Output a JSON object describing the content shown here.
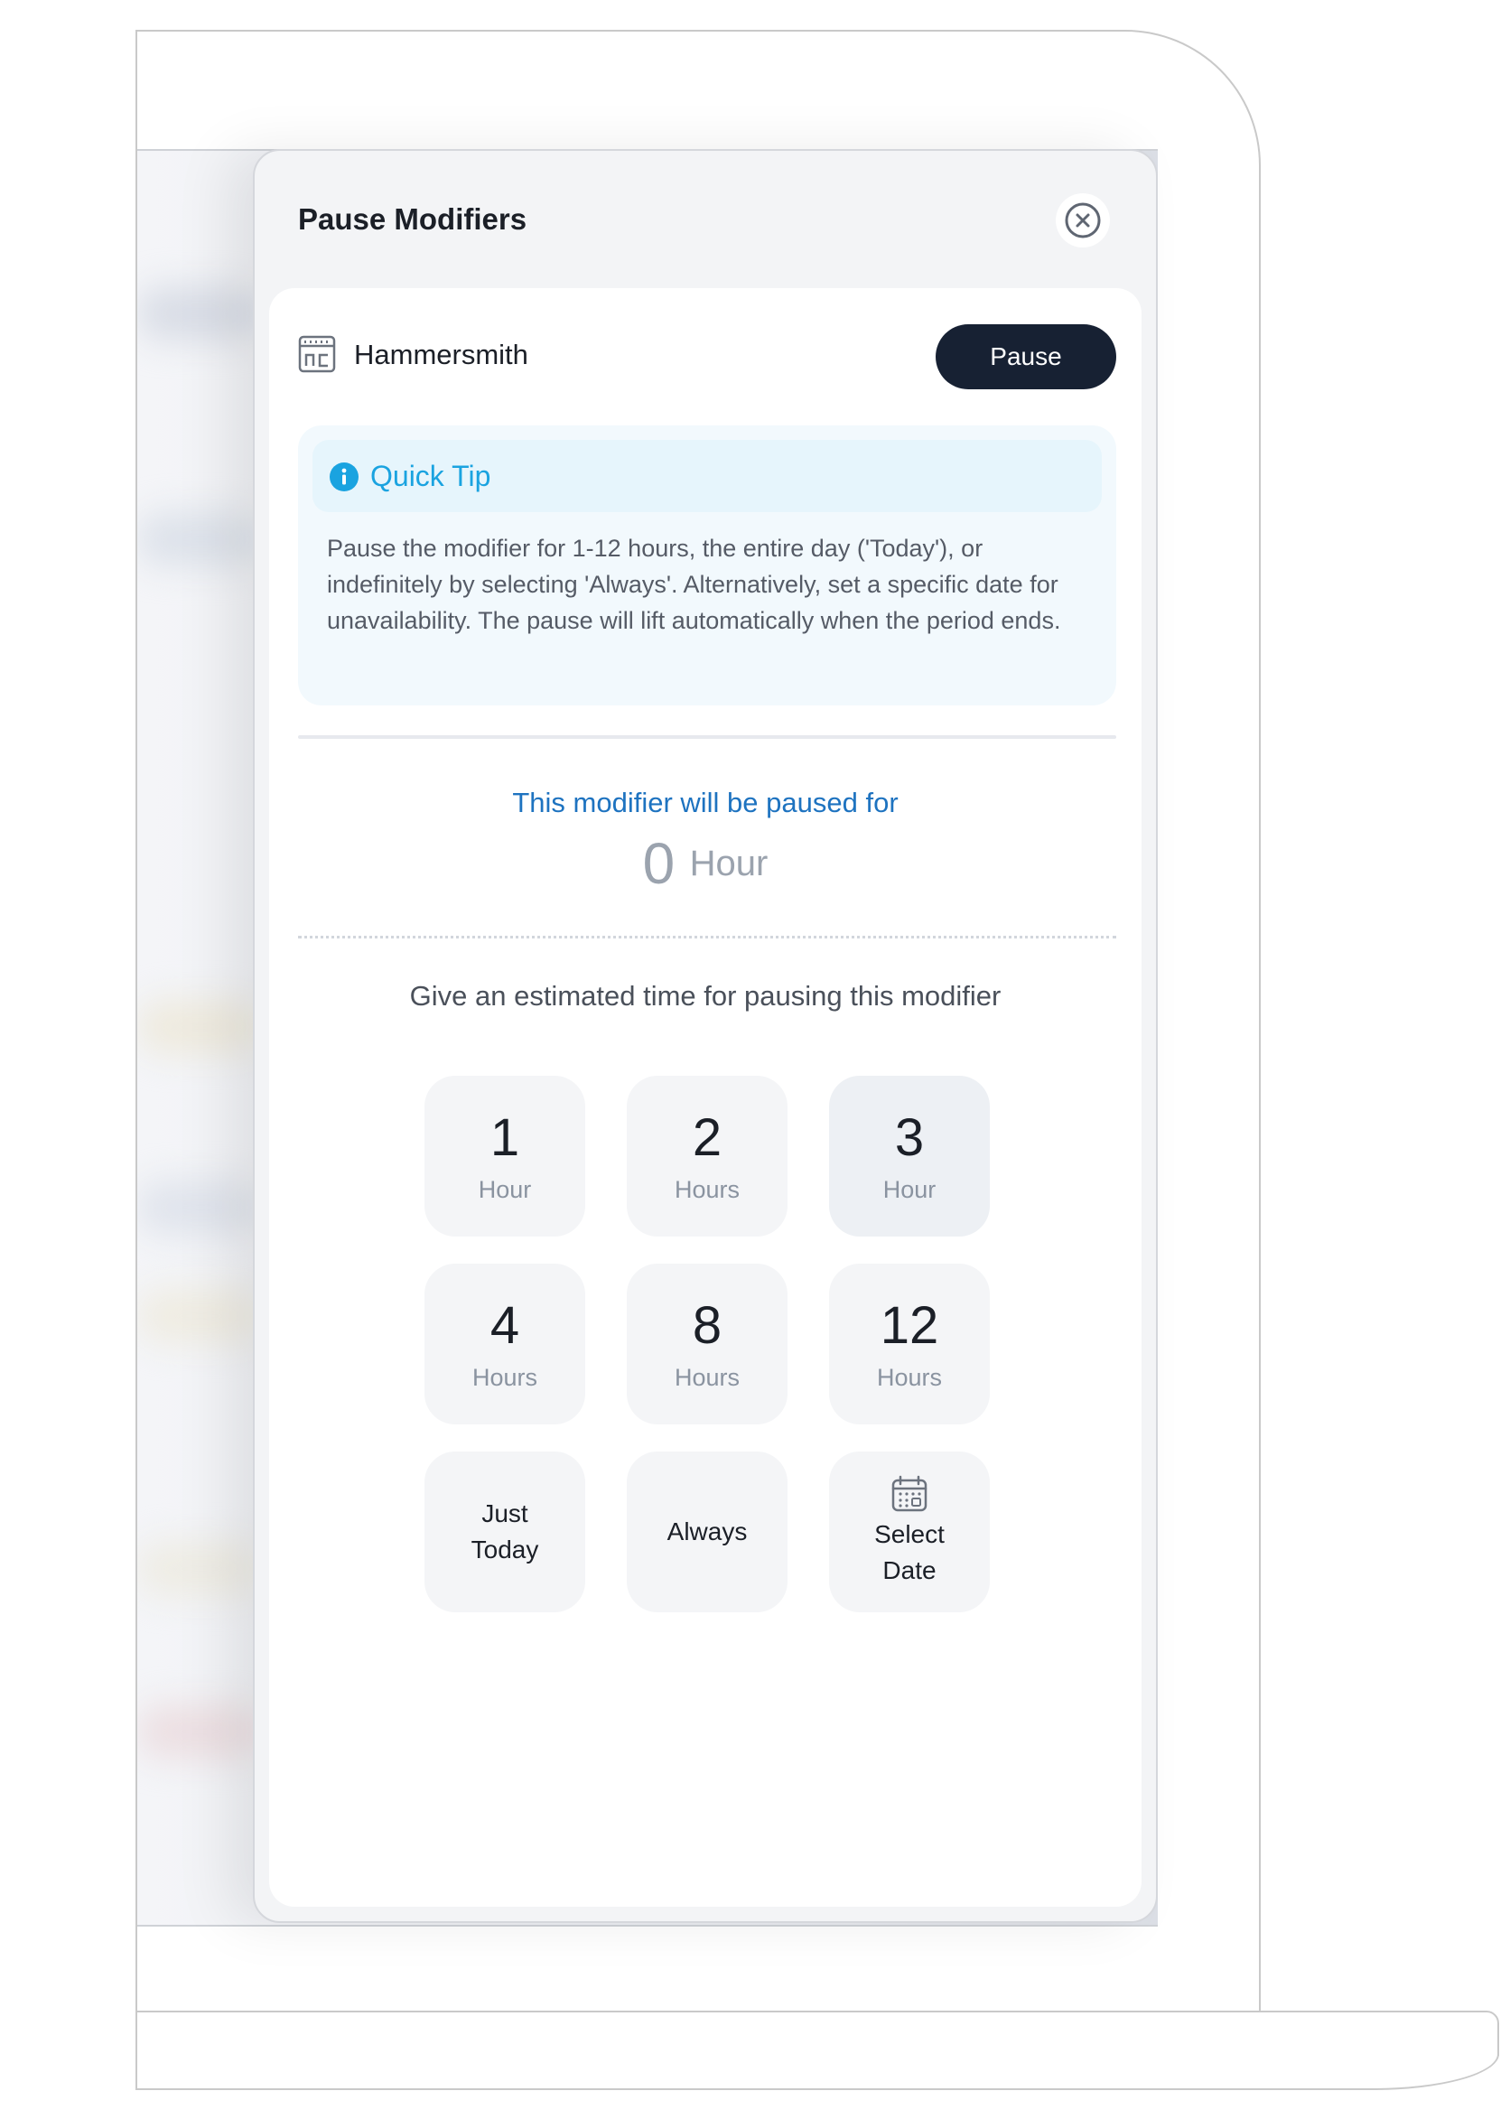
{
  "panel": {
    "title": "Pause Modifiers",
    "store": {
      "name": "Hammersmith",
      "icon": "store-icon"
    },
    "pause_button": "Pause",
    "tip": {
      "title": "Quick Tip",
      "text": "Pause the modifier for 1-12 hours, the entire day ('Today'), or indefinitely by selecting 'Always'. Alternatively, set a specific date for unavailability. The pause will lift automatically when the period ends."
    },
    "paused_label": "This modifier will be paused for",
    "paused_value": "0",
    "paused_unit": "Hour",
    "estimate_label": "Give an estimated time for pausing this modifier",
    "options": [
      {
        "num": "1",
        "unit": "Hour"
      },
      {
        "num": "2",
        "unit": "Hours"
      },
      {
        "num": "3",
        "unit": "Hour"
      },
      {
        "num": "4",
        "unit": "Hours"
      },
      {
        "num": "8",
        "unit": "Hours"
      },
      {
        "num": "12",
        "unit": "Hours"
      }
    ],
    "just_today": [
      "Just",
      "Today"
    ],
    "always": "Always",
    "select_date": [
      "Select",
      "Date"
    ]
  },
  "colors": {
    "accent": "#1aa3e0",
    "primary_dark": "#172133",
    "label_blue": "#1e73c0"
  }
}
